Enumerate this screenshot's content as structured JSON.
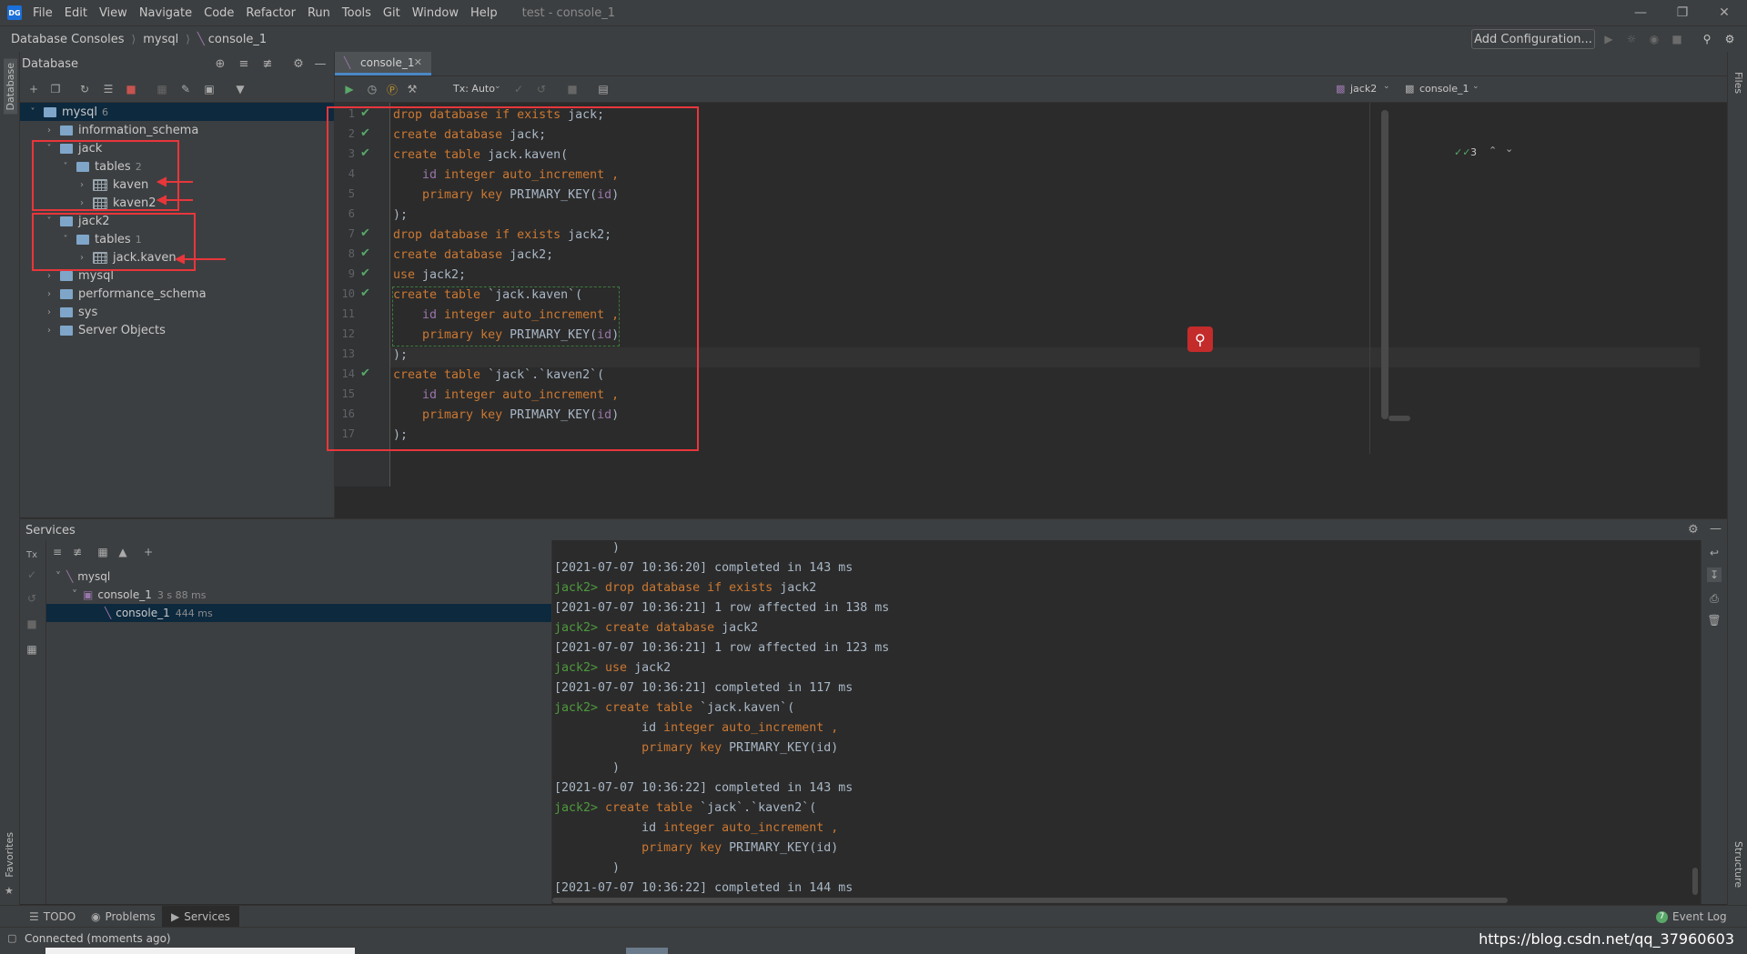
{
  "app": {
    "title": "test - console_1",
    "logo": "DG",
    "menu": [
      "File",
      "Edit",
      "View",
      "Navigate",
      "Code",
      "Refactor",
      "Run",
      "Tools",
      "Git",
      "Window",
      "Help"
    ]
  },
  "breadcrumb": [
    "Database Consoles",
    "mysql",
    "console_1"
  ],
  "navbar": {
    "add_config": "Add Configuration..."
  },
  "left_stripe": {
    "database": "Database",
    "favorites": "Favorites"
  },
  "right_stripe": {
    "files": "Files",
    "structure": "Structure"
  },
  "db_panel": {
    "title": "Database",
    "tree": [
      {
        "label": "mysql",
        "count": "6",
        "level": 0,
        "expanded": true,
        "kind": "db",
        "selected": true
      },
      {
        "label": "information_schema",
        "count": "",
        "level": 1,
        "expanded": false,
        "kind": "schema"
      },
      {
        "label": "jack",
        "count": "",
        "level": 1,
        "expanded": true,
        "kind": "schema"
      },
      {
        "label": "tables",
        "count": "2",
        "level": 2,
        "expanded": true,
        "kind": "folder"
      },
      {
        "label": "kaven",
        "count": "",
        "level": 3,
        "expanded": false,
        "kind": "table"
      },
      {
        "label": "kaven2",
        "count": "",
        "level": 3,
        "expanded": false,
        "kind": "table"
      },
      {
        "label": "jack2",
        "count": "",
        "level": 1,
        "expanded": true,
        "kind": "schema"
      },
      {
        "label": "tables",
        "count": "1",
        "level": 2,
        "expanded": true,
        "kind": "folder"
      },
      {
        "label": "jack.kaven",
        "count": "",
        "level": 3,
        "expanded": false,
        "kind": "table"
      },
      {
        "label": "mysql",
        "count": "",
        "level": 1,
        "expanded": false,
        "kind": "schema"
      },
      {
        "label": "performance_schema",
        "count": "",
        "level": 1,
        "expanded": false,
        "kind": "schema"
      },
      {
        "label": "sys",
        "count": "",
        "level": 1,
        "expanded": false,
        "kind": "schema"
      },
      {
        "label": "Server Objects",
        "count": "",
        "level": 1,
        "expanded": false,
        "kind": "folder"
      }
    ]
  },
  "editor": {
    "tab": "console_1",
    "tx_mode": "Tx: Auto",
    "schema_selector": "jack2",
    "session_selector": "console_1",
    "inspections_count": "3",
    "lines": [
      {
        "n": "1",
        "ok": true,
        "tokens": [
          [
            "kw",
            "drop database if exists "
          ],
          [
            "fn",
            "jack;"
          ]
        ]
      },
      {
        "n": "2",
        "ok": true,
        "tokens": [
          [
            "kw",
            "create database "
          ],
          [
            "fn",
            "jack;"
          ]
        ]
      },
      {
        "n": "3",
        "ok": true,
        "tokens": [
          [
            "kw",
            "create table "
          ],
          [
            "fn",
            "jack.kaven("
          ]
        ]
      },
      {
        "n": "4",
        "ok": false,
        "tokens": [
          [
            "lil",
            "    id "
          ],
          [
            "kw",
            "integer auto_increment ,"
          ]
        ]
      },
      {
        "n": "5",
        "ok": false,
        "tokens": [
          [
            "kw",
            "    primary key "
          ],
          [
            "fn",
            "PRIMARY_KEY("
          ],
          [
            "lil",
            "id"
          ],
          [
            "fn",
            ")"
          ]
        ]
      },
      {
        "n": "6",
        "ok": false,
        "tokens": [
          [
            "fn",
            ");"
          ]
        ]
      },
      {
        "n": "7",
        "ok": true,
        "tokens": [
          [
            "kw",
            "drop database if exists "
          ],
          [
            "fn",
            "jack2;"
          ]
        ]
      },
      {
        "n": "8",
        "ok": true,
        "tokens": [
          [
            "kw",
            "create database "
          ],
          [
            "fn",
            "jack2;"
          ]
        ]
      },
      {
        "n": "9",
        "ok": true,
        "tokens": [
          [
            "kw",
            "use "
          ],
          [
            "fn",
            "jack2;"
          ]
        ]
      },
      {
        "n": "10",
        "ok": true,
        "tokens": [
          [
            "kw",
            "create table "
          ],
          [
            "fn",
            "`jack.kaven`("
          ]
        ]
      },
      {
        "n": "11",
        "ok": false,
        "tokens": [
          [
            "lil",
            "    id "
          ],
          [
            "kw",
            "integer auto_increment ,"
          ]
        ]
      },
      {
        "n": "12",
        "ok": false,
        "tokens": [
          [
            "kw",
            "    primary key "
          ],
          [
            "fn",
            "PRIMARY_KEY("
          ],
          [
            "lil",
            "id"
          ],
          [
            "fn",
            ")"
          ]
        ]
      },
      {
        "n": "13",
        "ok": false,
        "tokens": [
          [
            "fn",
            ");"
          ]
        ]
      },
      {
        "n": "14",
        "ok": true,
        "tokens": [
          [
            "kw",
            "create table "
          ],
          [
            "fn",
            "`jack`.`kaven2`("
          ]
        ]
      },
      {
        "n": "15",
        "ok": false,
        "tokens": [
          [
            "lil",
            "    id "
          ],
          [
            "kw",
            "integer auto_increment ,"
          ]
        ]
      },
      {
        "n": "16",
        "ok": false,
        "tokens": [
          [
            "kw",
            "    primary key "
          ],
          [
            "fn",
            "PRIMARY_KEY("
          ],
          [
            "lil",
            "id"
          ],
          [
            "fn",
            ")"
          ]
        ]
      },
      {
        "n": "17",
        "ok": false,
        "tokens": [
          [
            "fn",
            ");"
          ]
        ]
      }
    ]
  },
  "services": {
    "title": "Services",
    "tree": [
      {
        "label": "mysql",
        "dur": "",
        "level": 0
      },
      {
        "label": "console_1",
        "dur": "3 s 88 ms",
        "level": 1
      },
      {
        "label": "console_1",
        "dur": "444 ms",
        "level": 2,
        "selected": true
      }
    ],
    "output": [
      [
        [
          "fn",
          "        )"
        ]
      ],
      [
        [
          "fn",
          "[2021-07-07 10:36:20] completed in 143 ms"
        ]
      ],
      [
        [
          "prompt",
          "jack2> "
        ],
        [
          "kw",
          "drop database if exists "
        ],
        [
          "fn",
          "jack2"
        ]
      ],
      [
        [
          "fn",
          "[2021-07-07 10:36:21] 1 row affected in 138 ms"
        ]
      ],
      [
        [
          "prompt",
          "jack2> "
        ],
        [
          "kw",
          "create database "
        ],
        [
          "fn",
          "jack2"
        ]
      ],
      [
        [
          "fn",
          "[2021-07-07 10:36:21] 1 row affected in 123 ms"
        ]
      ],
      [
        [
          "prompt",
          "jack2> "
        ],
        [
          "kw",
          "use "
        ],
        [
          "fn",
          "jack2"
        ]
      ],
      [
        [
          "fn",
          "[2021-07-07 10:36:21] completed in 117 ms"
        ]
      ],
      [
        [
          "prompt",
          "jack2> "
        ],
        [
          "kw",
          "create table "
        ],
        [
          "fn",
          "`jack.kaven`("
        ]
      ],
      [
        [
          "fn",
          "            id "
        ],
        [
          "kw",
          "integer auto_increment ,"
        ]
      ],
      [
        [
          "kw",
          "            primary key "
        ],
        [
          "fn",
          "PRIMARY_KEY(id)"
        ]
      ],
      [
        [
          "fn",
          "        )"
        ]
      ],
      [
        [
          "fn",
          "[2021-07-07 10:36:22] completed in 143 ms"
        ]
      ],
      [
        [
          "prompt",
          "jack2> "
        ],
        [
          "kw",
          "create table "
        ],
        [
          "fn",
          "`jack`.`kaven2`("
        ]
      ],
      [
        [
          "fn",
          "            id "
        ],
        [
          "kw",
          "integer auto_increment ,"
        ]
      ],
      [
        [
          "kw",
          "            primary key "
        ],
        [
          "fn",
          "PRIMARY_KEY(id)"
        ]
      ],
      [
        [
          "fn",
          "        )"
        ]
      ],
      [
        [
          "fn",
          "[2021-07-07 10:36:22] completed in 144 ms"
        ]
      ]
    ]
  },
  "tool_windows": {
    "todo": "TODO",
    "problems": "Problems",
    "services": "Services",
    "event_log": "Event Log",
    "event_count": "7"
  },
  "status": {
    "text": "Connected (moments ago)",
    "watermark": "https://blog.csdn.net/qq_37960603"
  },
  "colors": {
    "accent": "#4a88c7",
    "annotation": "#e8363b",
    "ok": "#59a869",
    "keyword": "#cc7832"
  }
}
